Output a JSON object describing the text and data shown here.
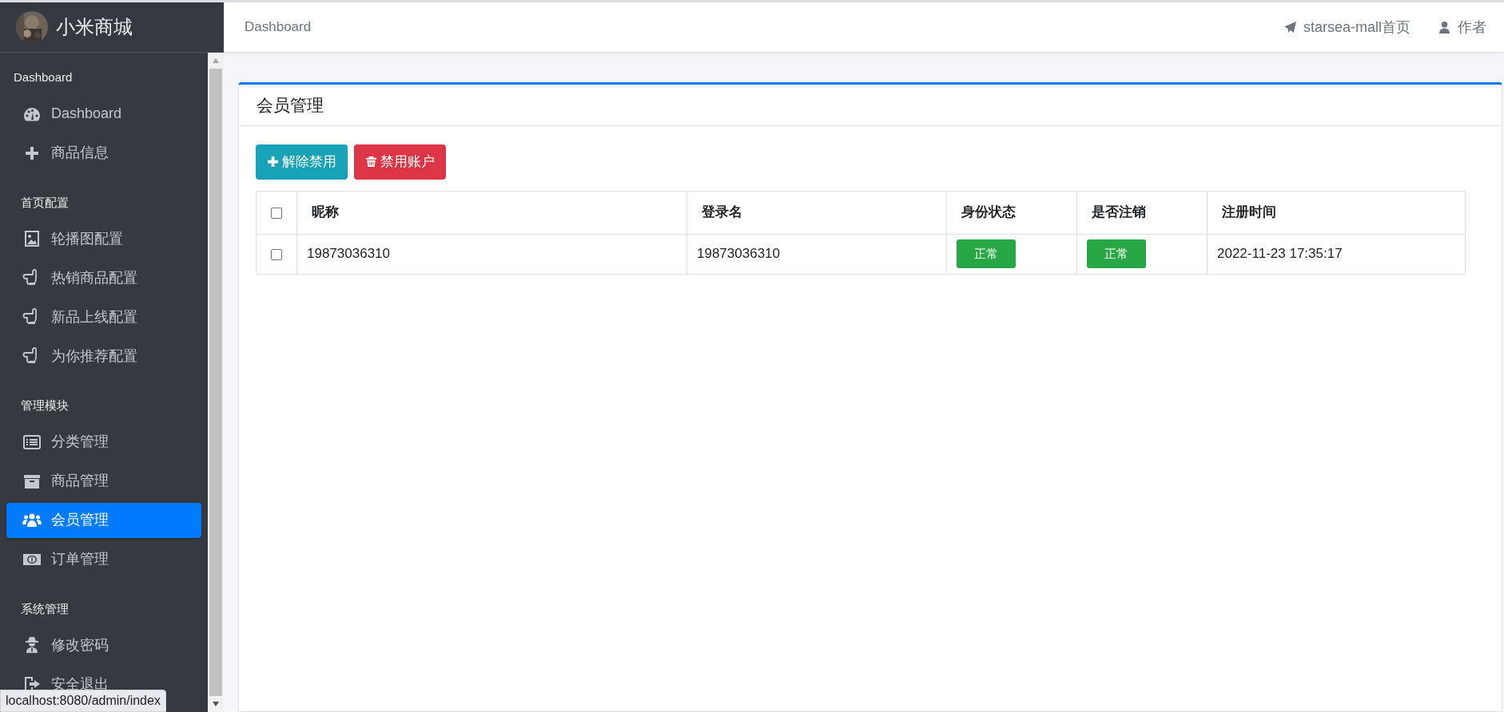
{
  "brand": {
    "title": "小米商城"
  },
  "sidebar": {
    "sections": [
      {
        "title": "Dashboard",
        "items": [
          {
            "label": "Dashboard",
            "selected": false
          },
          {
            "label": "商品信息",
            "selected": false
          }
        ]
      },
      {
        "title": "首页配置",
        "items": [
          {
            "label": "轮播图配置",
            "selected": false
          },
          {
            "label": "热销商品配置",
            "selected": false
          },
          {
            "label": "新品上线配置",
            "selected": false
          },
          {
            "label": "为你推荐配置",
            "selected": false
          }
        ]
      },
      {
        "title": "管理模块",
        "items": [
          {
            "label": "分类管理",
            "selected": false
          },
          {
            "label": "商品管理",
            "selected": false
          },
          {
            "label": "会员管理",
            "selected": true
          },
          {
            "label": "订单管理",
            "selected": false
          }
        ]
      },
      {
        "title": "系统管理",
        "items": [
          {
            "label": "修改密码",
            "selected": false
          },
          {
            "label": "安全退出",
            "selected": false
          }
        ]
      }
    ]
  },
  "status_url": "localhost:8080/admin/index",
  "topbar": {
    "breadcrumb": "Dashboard",
    "links": [
      "starsea-mall首页",
      "作者"
    ]
  },
  "card": {
    "title": "会员管理",
    "buttons": [
      {
        "label": "解除禁用",
        "kind": "info"
      },
      {
        "label": "禁用账户",
        "kind": "danger"
      }
    ],
    "table": {
      "header_checked": false,
      "columns": [
        "昵称",
        "登录名",
        "身份状态",
        "是否注销",
        "注册时间"
      ],
      "rows": [
        {
          "checked": false,
          "cells": [
            {
              "kind": "text",
              "text": "19873036310"
            },
            {
              "kind": "text",
              "text": "19873036310"
            },
            {
              "kind": "badge",
              "text": "正常"
            },
            {
              "kind": "badge",
              "text": "正常"
            },
            {
              "kind": "text",
              "text": "2022-11-23 17:35:17"
            }
          ]
        }
      ]
    }
  }
}
